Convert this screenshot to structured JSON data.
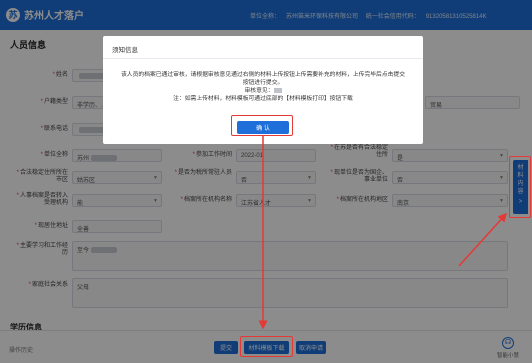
{
  "header": {
    "logo_glyph": "苏",
    "title": "苏州人才落户",
    "org_label": "单位全称：",
    "org_name": "苏州笛米环保科技有限公司",
    "credit_label": "统一社会信用代码：",
    "credit_code": "91320581310525814K"
  },
  "section": {
    "person_info": "人员信息",
    "edu_info": "学历信息"
  },
  "form": {
    "name_label": "姓名",
    "nation_label": "户籍类型",
    "nation_value": "非学历、…",
    "phone_label": "联系电话",
    "unit_label": "单位全称",
    "unit_value": "苏州",
    "work_time_label": "参加工作时间",
    "work_time_value": "2022-01",
    "social_label": "在苏是否有合法稳定住所",
    "social_value": "是",
    "district_label": "合法稳定住所所在市区",
    "district_value": "姑苏区",
    "tax_label": "是否为税所常驻人员",
    "tax_value": "否",
    "enterprise_label": "现单位是否为国企、事业单位",
    "enterprise_value": "否",
    "settle_label": "人事档案是否转入受理机构",
    "settle_value": "能",
    "file_label": "档案所在机构名称",
    "file_value": "江苏省人才",
    "file_city_label": "档案所在机构地区",
    "file_city_value": "南京",
    "address_label": "现居住地址",
    "address_value": "全善",
    "resume_label": "主要学习和工作经历",
    "resume_value": "至今",
    "family_label": "家庭社会关系",
    "family_value": "父母",
    "right_trim_value": "贸易"
  },
  "modal": {
    "title": "须知信息",
    "line1": "该人员的档案已通过审核，请根据审核意见通过右侧的材料上传按钮上传需要补充的材料，上传完毕后点击提交按钮进行提交。",
    "line2": "审核意见：",
    "line3": "注：如需上传材料，材料模板可通过底部的【材料模板打印】按钮下载",
    "confirm_label": "确 认"
  },
  "footer": {
    "history_label": "操作历史",
    "submit_label": "提交",
    "template_label": "材料模板下载",
    "cancel_label": "取消申请",
    "assistant_label": "智能小慧",
    "assistant_glyph": "☊"
  },
  "sidetab": {
    "chars": [
      "材",
      "料",
      "内",
      "容"
    ],
    "more": ">"
  },
  "colors": {
    "primary": "#1e6fd9",
    "highlight": "#e53935"
  }
}
